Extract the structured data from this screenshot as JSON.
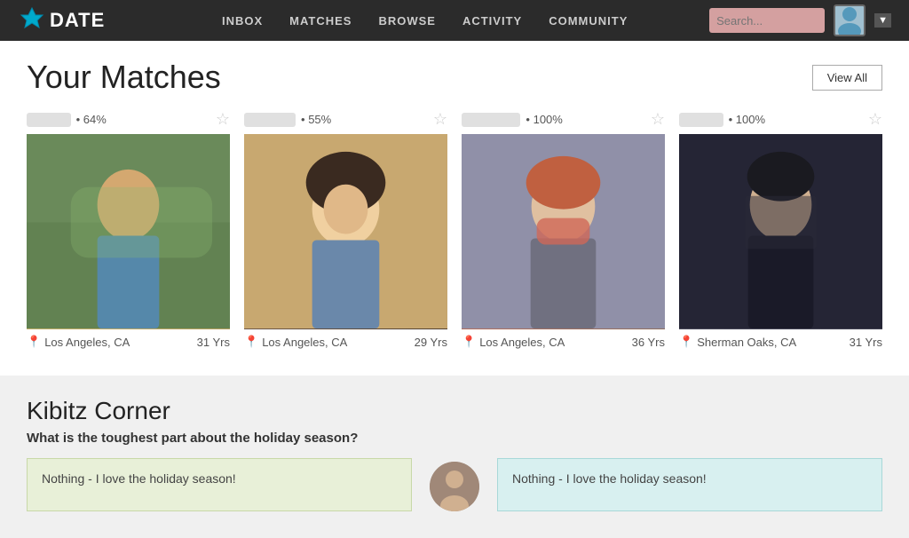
{
  "nav": {
    "logo_text": "DATE",
    "links": [
      {
        "label": "INBOX",
        "id": "inbox"
      },
      {
        "label": "MATCHES",
        "id": "matches"
      },
      {
        "label": "BROWSE",
        "id": "browse"
      },
      {
        "label": "ACTIVITY",
        "id": "activity"
      },
      {
        "label": "COMMUNITY",
        "id": "community"
      }
    ],
    "search_placeholder": "Search...",
    "dropdown_label": "▼"
  },
  "page": {
    "title": "Your Matches",
    "view_all_label": "View All"
  },
  "matches": [
    {
      "name_blur": "••••••••",
      "percent": "64%",
      "location": "Los Angeles, CA",
      "age": "31 Yrs",
      "photo_class": "photo-1"
    },
    {
      "name_blur": "••••••••••",
      "percent": "55%",
      "location": "Los Angeles, CA",
      "age": "29 Yrs",
      "photo_class": "photo-2"
    },
    {
      "name_blur": "••••••••••••",
      "percent": "100%",
      "location": "Los Angeles, CA",
      "age": "36 Yrs",
      "photo_class": "photo-3"
    },
    {
      "name_blur": "••••••••",
      "percent": "100%",
      "location": "Sherman Oaks, CA",
      "age": "31 Yrs",
      "photo_class": "photo-4"
    }
  ],
  "kibitz": {
    "title": "Kibitz Corner",
    "question": "What is the toughest part about the holiday season?",
    "card_left_text": "Nothing - I love the holiday season!",
    "card_right_text": "Nothing - I love the holiday season!"
  }
}
